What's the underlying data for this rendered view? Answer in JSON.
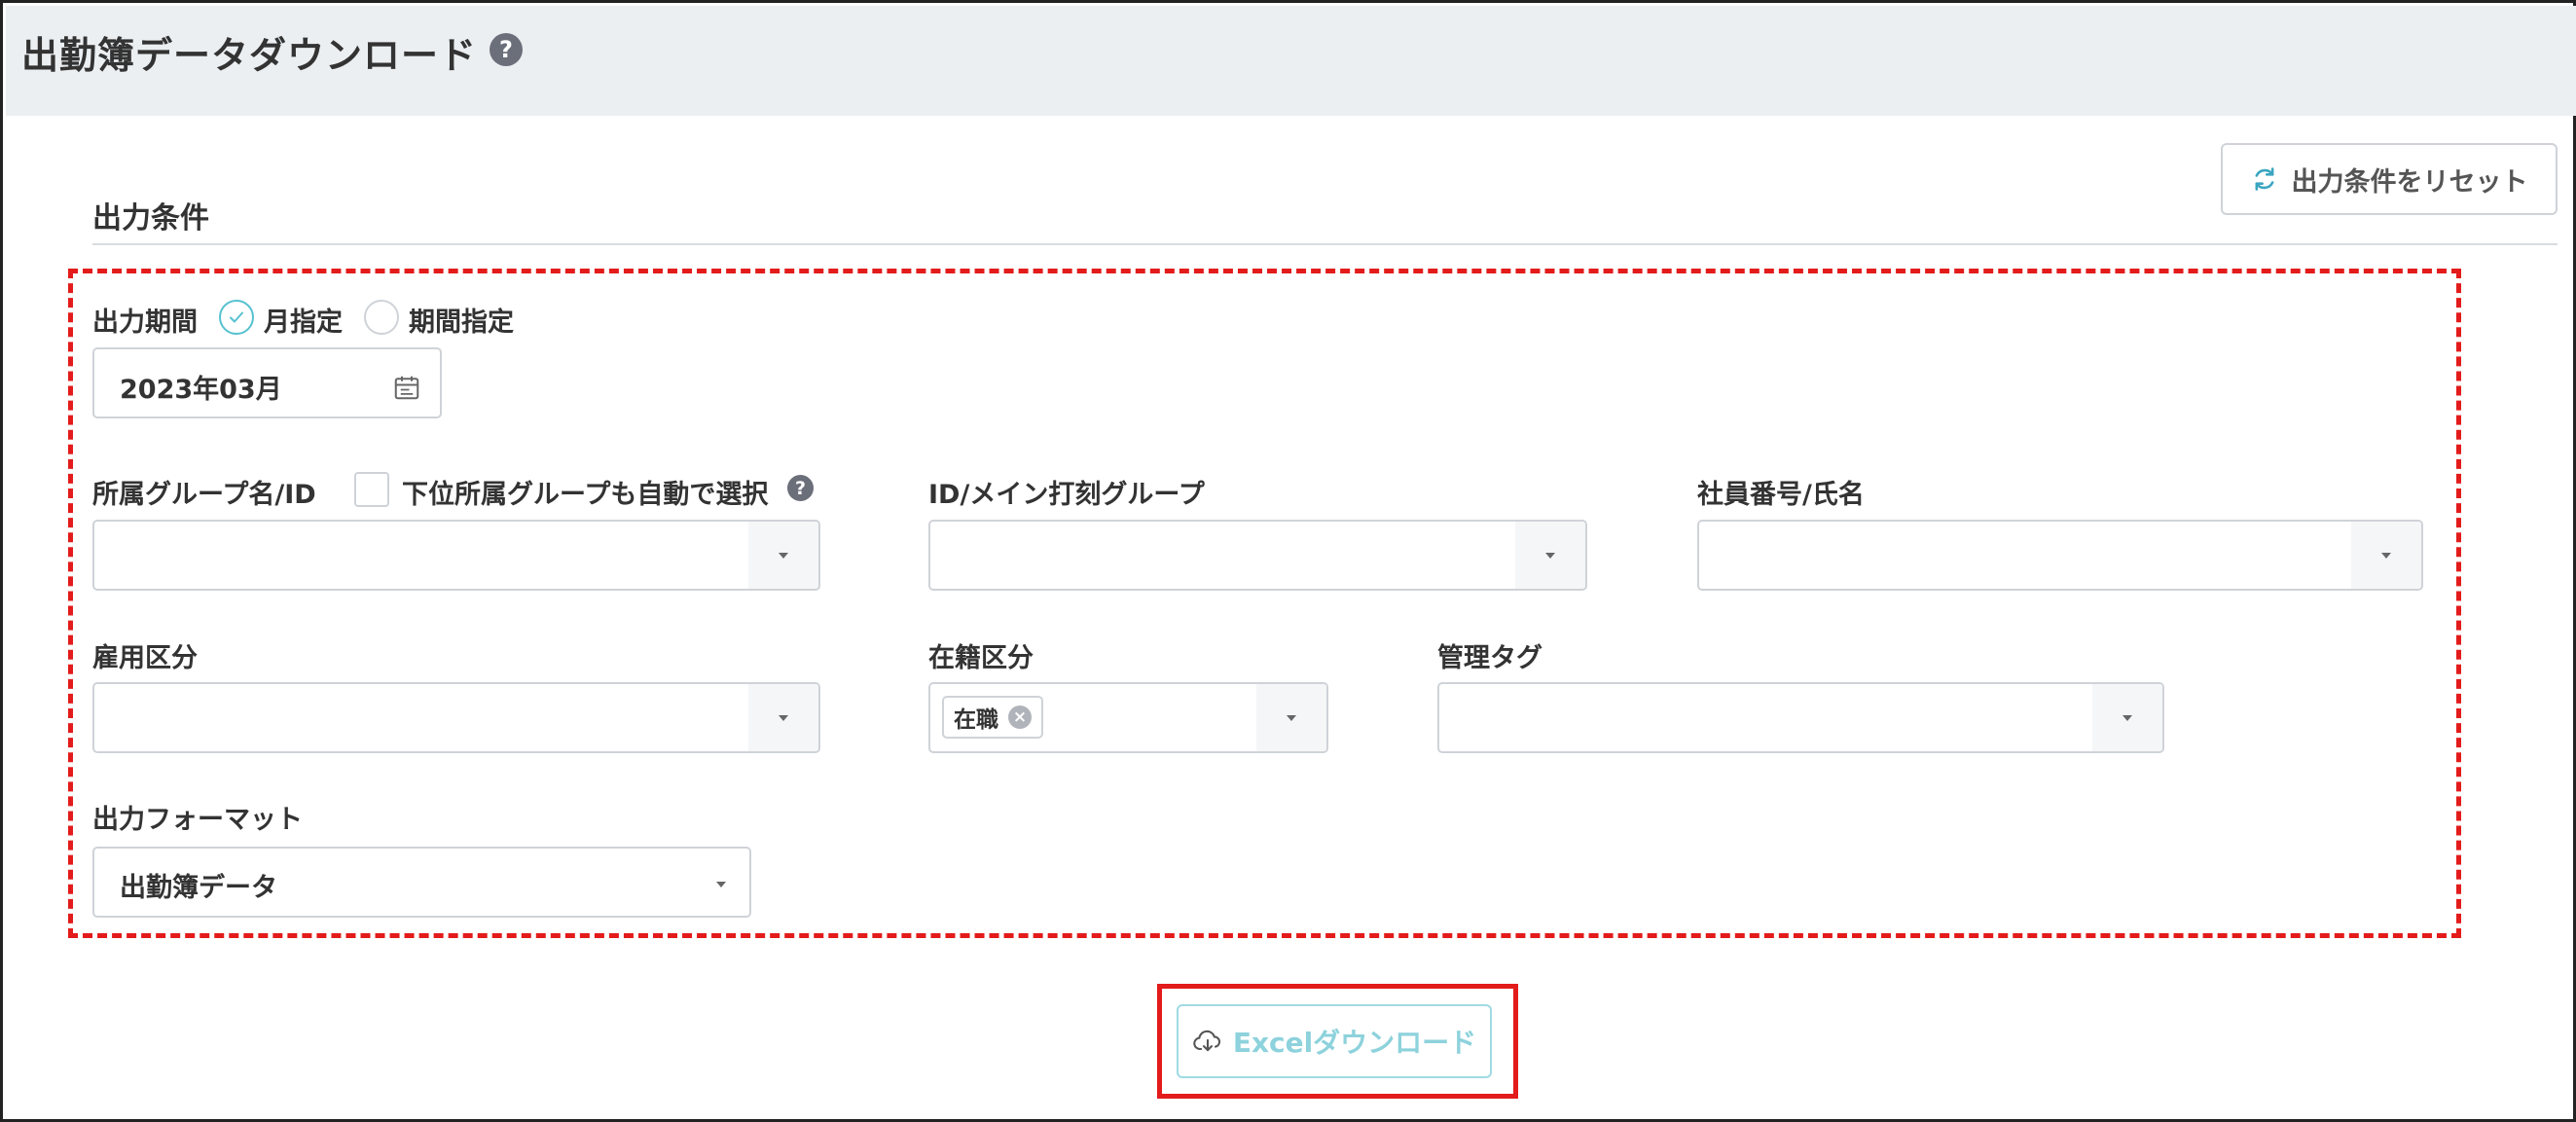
{
  "page": {
    "title": "出勤簿データダウンロード",
    "help_glyph": "?"
  },
  "toolbar": {
    "reset_label": "出力条件をリセット"
  },
  "section": {
    "title": "出力条件"
  },
  "period": {
    "label": "出力期間",
    "options": [
      "月指定",
      "期間指定"
    ],
    "selected": "月指定",
    "month_value": "2023年03月"
  },
  "filters": {
    "group_label": "所属グループ名/ID",
    "subgroup_checkbox_label": "下位所属グループも自動で選択",
    "punch_group_label": "ID/メイン打刻グループ",
    "employee_label": "社員番号/氏名",
    "employment_label": "雇用区分",
    "enrollment_label": "在籍区分",
    "enrollment_tag": "在職",
    "tag_remove_glyph": "×",
    "mgmt_tag_label": "管理タグ"
  },
  "format": {
    "label": "出力フォーマット",
    "selected": "出勤簿データ"
  },
  "download": {
    "label": "Excelダウンロード"
  },
  "colors": {
    "accent": "#56c1d0",
    "highlight_red": "#e31b1b",
    "header_bg": "#eceff2"
  },
  "icons": {
    "reset": "refresh-icon",
    "calendar": "calendar-icon",
    "download": "cloud-download-icon",
    "help": "question-circle-icon"
  }
}
